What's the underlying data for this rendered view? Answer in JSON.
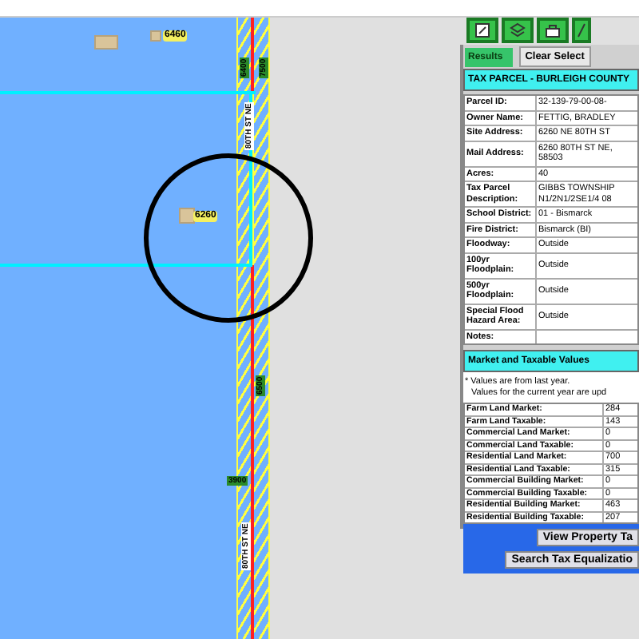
{
  "map": {
    "address_labels": [
      {
        "text": "6460"
      },
      {
        "text": "6260"
      }
    ],
    "road_labels": [
      "80TH ST NE",
      "80TH ST NE"
    ],
    "range_labels": [
      "6400",
      "7500",
      "6500",
      "3900"
    ]
  },
  "results_panel": {
    "tab": "Results",
    "clear_button": "Clear Select",
    "title": "TAX PARCEL - BURLEIGH COUNTY",
    "parcel_fields": [
      {
        "label": "Parcel ID:",
        "value": "32-139-79-00-08-"
      },
      {
        "label": "Owner Name:",
        "value": "FETTIG, BRADLEY"
      },
      {
        "label": "Site Address:",
        "value": "6260 NE 80TH ST"
      },
      {
        "label": "Mail Address:",
        "value": "6260 80TH ST NE,\n58503"
      },
      {
        "label": "Acres:",
        "value": "40"
      },
      {
        "label": "Tax Parcel\nDescription:",
        "value": "GIBBS TOWNSHIP\nN1/2N1/2SE1/4 08"
      },
      {
        "label": "School District:",
        "value": "01 - Bismarck"
      },
      {
        "label": "Fire District:",
        "value": "Bismarck (BI)"
      },
      {
        "label": "Floodway:",
        "value": "Outside"
      },
      {
        "label": "100yr\nFloodplain:",
        "value": "Outside"
      },
      {
        "label": "500yr\nFloodplain:",
        "value": "Outside"
      },
      {
        "label": "Special Flood\nHazard Area:",
        "value": "Outside"
      },
      {
        "label": "Notes:"
      }
    ],
    "section_title": "Market and Taxable Values",
    "notes": [
      "* Values are from last year.",
      "Values for the current year are upd"
    ],
    "values": [
      {
        "label": "Farm Land Market:",
        "value": "284"
      },
      {
        "label": "Farm Land Taxable:",
        "value": "143"
      },
      {
        "label": "Commercial Land Market:",
        "value": "0"
      },
      {
        "label": "Commercial Land Taxable:",
        "value": "0"
      },
      {
        "label": "Residential Land Market:",
        "value": "700"
      },
      {
        "label": "Residential Land Taxable:",
        "value": "315"
      },
      {
        "label": "Commercial Building Market:",
        "value": "0"
      },
      {
        "label": "Commercial Building Taxable:",
        "value": "0"
      },
      {
        "label": "Residential Building Market:",
        "value": "463"
      },
      {
        "label": "Residential Building Taxable:",
        "value": "207"
      }
    ],
    "buttons": [
      "View Property Ta",
      "Search Tax Equalizatio"
    ]
  }
}
